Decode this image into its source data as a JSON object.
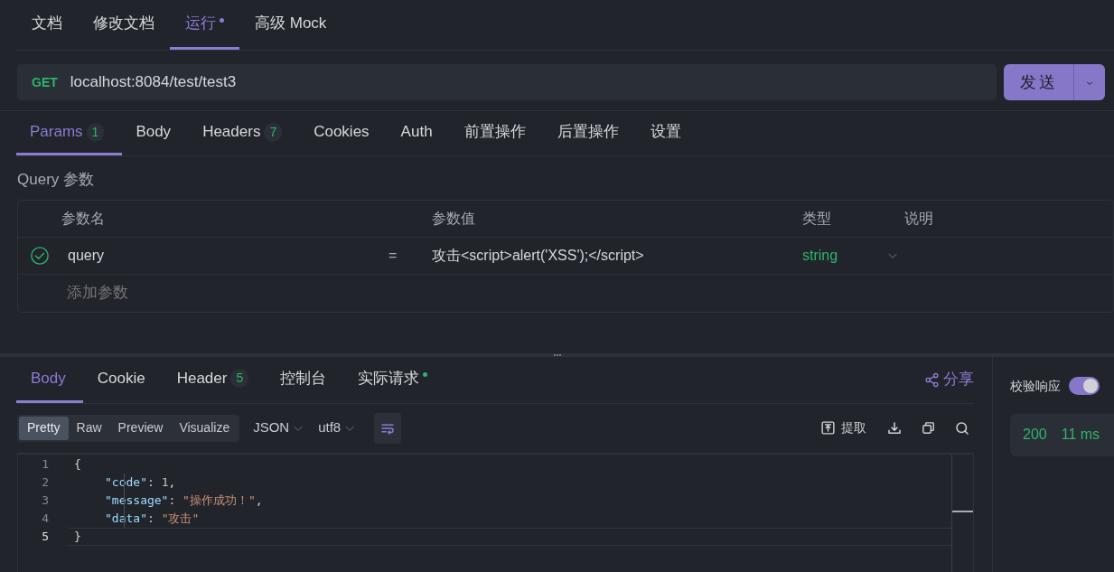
{
  "doc_tabs": [
    {
      "label": "文档",
      "selected": false,
      "dot": false
    },
    {
      "label": "修改文档",
      "selected": false,
      "dot": false
    },
    {
      "label": "运行",
      "selected": true,
      "dot": true
    },
    {
      "label": "高级 Mock",
      "selected": false,
      "dot": false
    }
  ],
  "request": {
    "method": "GET",
    "url": "localhost:8084/test/test3",
    "send_label": "发送"
  },
  "request_tabs": [
    {
      "label": "Params",
      "count": "1",
      "selected": true
    },
    {
      "label": "Body",
      "selected": false
    },
    {
      "label": "Headers",
      "count": "7",
      "selected": false
    },
    {
      "label": "Cookies",
      "selected": false
    },
    {
      "label": "Auth",
      "selected": false
    },
    {
      "label": "前置操作",
      "selected": false
    },
    {
      "label": "后置操作",
      "selected": false
    },
    {
      "label": "设置",
      "selected": false
    }
  ],
  "query_title": "Query 参数",
  "params_table": {
    "columns": [
      "参数名",
      "参数值",
      "类型",
      "说明"
    ],
    "rows": [
      {
        "enabled": true,
        "name": "query",
        "operator": "=",
        "value": "攻击<script>alert('XSS');</script>",
        "type": "string"
      }
    ],
    "add_placeholder": "添加参数"
  },
  "response_tabs": [
    {
      "label": "Body",
      "selected": true,
      "dot": false
    },
    {
      "label": "Cookie",
      "selected": false,
      "dot": false
    },
    {
      "label": "Header",
      "count": "5",
      "selected": false,
      "dot": false
    },
    {
      "label": "控制台",
      "selected": false,
      "dot": false
    },
    {
      "label": "实际请求",
      "selected": false,
      "dot": true
    }
  ],
  "share_label": "分享",
  "view_modes": [
    {
      "label": "Pretty",
      "selected": true
    },
    {
      "label": "Raw",
      "selected": false
    },
    {
      "label": "Preview",
      "selected": false
    },
    {
      "label": "Visualize",
      "selected": false
    }
  ],
  "format": "JSON",
  "encoding": "utf8",
  "extract_label": "提取",
  "code_lines": [
    {
      "number": "1",
      "current": false,
      "tokens": [
        {
          "kind": "punct",
          "text": "{"
        }
      ]
    },
    {
      "number": "2",
      "current": false,
      "tokens": [
        {
          "kind": "key",
          "text": "\"code\""
        },
        {
          "kind": "punct",
          "text": ": "
        },
        {
          "kind": "number",
          "text": "1"
        },
        {
          "kind": "punct",
          "text": ","
        }
      ]
    },
    {
      "number": "3",
      "current": false,
      "tokens": [
        {
          "kind": "key",
          "text": "\"message\""
        },
        {
          "kind": "punct",
          "text": ": "
        },
        {
          "kind": "string",
          "text": "\"操作成功！\""
        },
        {
          "kind": "punct",
          "text": ","
        }
      ]
    },
    {
      "number": "4",
      "current": false,
      "tokens": [
        {
          "kind": "key",
          "text": "\"data\""
        },
        {
          "kind": "punct",
          "text": ": "
        },
        {
          "kind": "string",
          "text": "\"攻击\""
        }
      ]
    },
    {
      "number": "5",
      "current": true,
      "tokens": [
        {
          "kind": "punct",
          "text": "}"
        }
      ]
    }
  ],
  "validate": {
    "label": "校验响应",
    "on": true
  },
  "status": {
    "code": "200",
    "time": "11 ms"
  }
}
